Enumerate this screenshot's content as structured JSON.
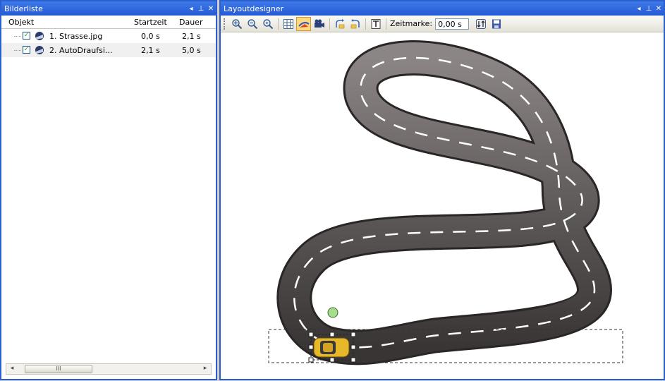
{
  "left_panel": {
    "title": "Bilderliste",
    "columns": {
      "object": "Objekt",
      "start": "Startzeit",
      "duration": "Dauer"
    },
    "rows": [
      {
        "name": "1. Strasse.jpg",
        "start": "0,0 s",
        "duration": "2,1 s",
        "checked": true
      },
      {
        "name": "2. AutoDraufsi...",
        "start": "2,1 s",
        "duration": "5,0 s",
        "checked": true
      }
    ],
    "scrollbar_grip": "III"
  },
  "right_panel": {
    "title": "Layoutdesigner",
    "toolbar": {
      "time_label": "Zeitmarke:",
      "time_value": "0,00 s",
      "icons": [
        "zoom-in-icon",
        "zoom-out-icon",
        "zoom-reset-icon",
        "grid-icon",
        "path-mode-icon",
        "camera-icon",
        "rotate-left-icon",
        "rotate-right-icon",
        "text-object-icon",
        "time-toggle-icon",
        "save-icon"
      ]
    }
  },
  "colors": {
    "title_blue": "#245ad6",
    "road_dark": "#4a4545",
    "road_light": "#8c8585",
    "lane_marking": "#ffffff",
    "car_yellow": "#e8b82b",
    "start_marker": "#a6dd8c",
    "active_tool": "#ffd882"
  }
}
